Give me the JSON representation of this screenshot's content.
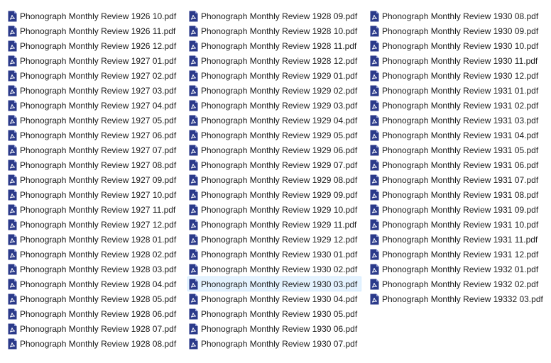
{
  "icon": "pdf-file-icon",
  "accent_color": "#2b3a8a",
  "selection_color": "#e5f3ff",
  "selected_file": "Phonograph Monthly Review 1930 03.pdf",
  "columns": [
    [
      "Phonograph Monthly Review 1926 10.pdf",
      "Phonograph Monthly Review 1926 11.pdf",
      "Phonograph Monthly Review 1926 12.pdf",
      "Phonograph Monthly Review 1927 01.pdf",
      "Phonograph Monthly Review 1927 02.pdf",
      "Phonograph Monthly Review 1927 03.pdf",
      "Phonograph Monthly Review 1927 04.pdf",
      "Phonograph Monthly Review 1927 05.pdf",
      "Phonograph Monthly Review 1927 06.pdf",
      "Phonograph Monthly Review 1927 07.pdf",
      "Phonograph Monthly Review 1927 08.pdf",
      "Phonograph Monthly Review 1927 09.pdf",
      "Phonograph Monthly Review 1927 10.pdf",
      "Phonograph Monthly Review 1927 11.pdf",
      "Phonograph Monthly Review 1927 12.pdf",
      "Phonograph Monthly Review 1928 01.pdf",
      "Phonograph Monthly Review 1928 02.pdf",
      "Phonograph Monthly Review 1928 03.pdf",
      "Phonograph Monthly Review 1928 04.pdf",
      "Phonograph Monthly Review 1928 05.pdf",
      "Phonograph Monthly Review 1928 06.pdf",
      "Phonograph Monthly Review 1928 07.pdf",
      "Phonograph Monthly Review 1928 08.pdf"
    ],
    [
      "Phonograph Monthly Review 1928 09.pdf",
      "Phonograph Monthly Review 1928 10.pdf",
      "Phonograph Monthly Review 1928 11.pdf",
      "Phonograph Monthly Review 1928 12.pdf",
      "Phonograph Monthly Review 1929 01.pdf",
      "Phonograph Monthly Review 1929 02.pdf",
      "Phonograph Monthly Review 1929 03.pdf",
      "Phonograph Monthly Review 1929 04.pdf",
      "Phonograph Monthly Review 1929 05.pdf",
      "Phonograph Monthly Review 1929 06.pdf",
      "Phonograph Monthly Review 1929 07.pdf",
      "Phonograph Monthly Review 1929 08.pdf",
      "Phonograph Monthly Review 1929 09.pdf",
      "Phonograph Monthly Review 1929 10.pdf",
      "Phonograph Monthly Review 1929 11.pdf",
      "Phonograph Monthly Review 1929 12.pdf",
      "Phonograph Monthly Review 1930 01.pdf",
      "Phonograph Monthly Review 1930 02.pdf",
      "Phonograph Monthly Review 1930 03.pdf",
      "Phonograph Monthly Review 1930 04.pdf",
      "Phonograph Monthly Review 1930 05.pdf",
      "Phonograph Monthly Review 1930 06.pdf",
      "Phonograph Monthly Review 1930 07.pdf"
    ],
    [
      "Phonograph Monthly Review 1930 08.pdf",
      "Phonograph Monthly Review 1930 09.pdf",
      "Phonograph Monthly Review 1930 10.pdf",
      "Phonograph Monthly Review 1930 11.pdf",
      "Phonograph Monthly Review 1930 12.pdf",
      "Phonograph Monthly Review 1931 01.pdf",
      "Phonograph Monthly Review 1931 02.pdf",
      "Phonograph Monthly Review 1931 03.pdf",
      "Phonograph Monthly Review 1931 04.pdf",
      "Phonograph Monthly Review 1931 05.pdf",
      "Phonograph Monthly Review 1931 06.pdf",
      "Phonograph Monthly Review 1931 07.pdf",
      "Phonograph Monthly Review 1931 08.pdf",
      "Phonograph Monthly Review 1931 09.pdf",
      "Phonograph Monthly Review 1931 10.pdf",
      "Phonograph Monthly Review 1931 11.pdf",
      "Phonograph Monthly Review 1931 12.pdf",
      "Phonograph Monthly Review 1932 01.pdf",
      "Phonograph Monthly Review 1932 02.pdf",
      "Phonograph Monthly Review 19332 03.pdf"
    ]
  ]
}
